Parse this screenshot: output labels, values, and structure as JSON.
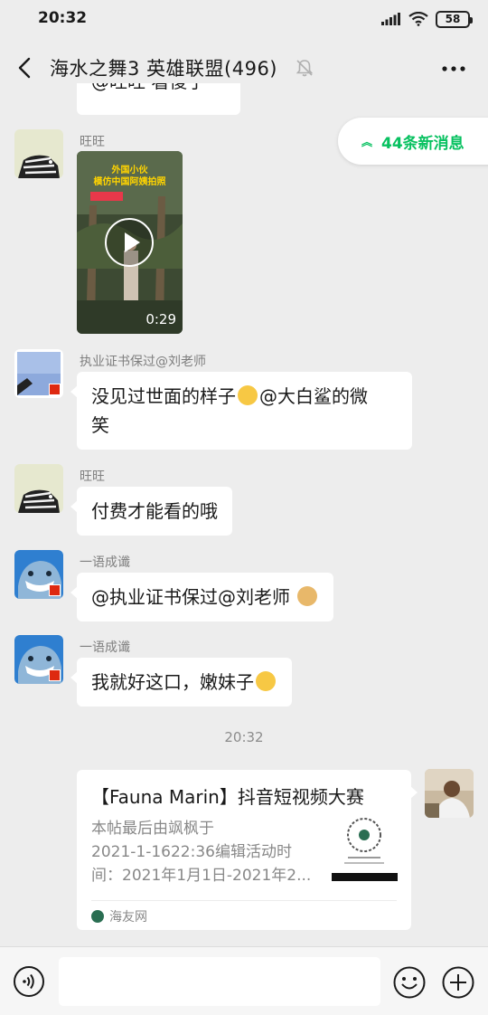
{
  "status_bar": {
    "time": "20:32",
    "battery": "58"
  },
  "title_bar": {
    "title": "海水之舞3 英雄联盟(496)"
  },
  "new_messages": {
    "label": "44条新消息"
  },
  "partial_message": {
    "text": "@旺旺 看傻了"
  },
  "messages": [
    {
      "sender": "旺旺",
      "type": "video",
      "video": {
        "caption_line1": "外国小伙",
        "caption_line2": "模仿中国阿姨拍照",
        "duration": "0:29"
      }
    },
    {
      "sender": "执业证书保过@刘老师",
      "type": "text",
      "line1": "没见过世面的样子",
      "line1_after": "@大白鲨的微",
      "line2": "笑"
    },
    {
      "sender": "旺旺",
      "type": "text",
      "text": "付费才能看的哦"
    },
    {
      "sender": "一语成谶",
      "type": "text",
      "text": "@执业证书保过@刘老师"
    },
    {
      "sender": "一语成谶",
      "type": "text",
      "text": "我就好这口，嫩妹子"
    }
  ],
  "timestamp": "20:32",
  "link_card": {
    "title": "【Fauna Marin】抖音短视频大赛",
    "desc_line1": "本帖最后由飒枫于",
    "desc_line2": "2021-1-1622:36编辑活动时",
    "desc_line3": "间：2021年1月1日-2021年2...",
    "source": "海友网"
  },
  "input_bar": {
    "placeholder": ""
  },
  "colors": {
    "accent": "#07c160",
    "background": "#ededed",
    "bubble": "#ffffff"
  }
}
